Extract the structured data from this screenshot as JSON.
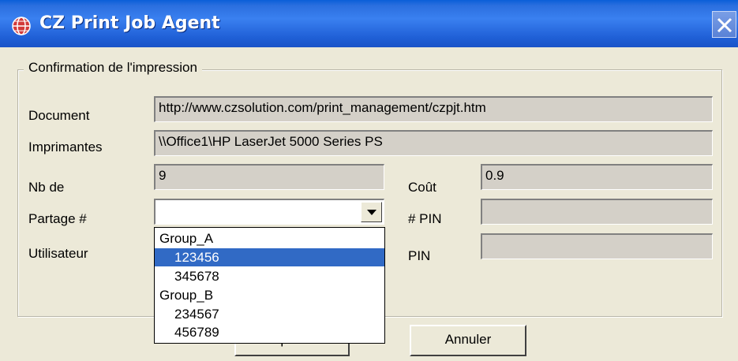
{
  "window": {
    "title": "CZ Print Job Agent",
    "app_icon": "globe-icon",
    "close_icon": "close-icon"
  },
  "group": {
    "legend": "Confirmation de l'impression"
  },
  "fields": {
    "document_label": "Document",
    "document_value": "http://www.czsolution.com/print_management/czpjt.htm",
    "printer_label": "Imprimantes",
    "printer_value": "\\\\Office1\\HP LaserJet 5000 Series PS",
    "nb_label": "Nb de",
    "nb_value": "9",
    "cost_label": "Coût",
    "cost_value": "0.9",
    "share_label": "Partage  #",
    "share_value": "",
    "pin_number_label": "# PIN",
    "pin_number_value": "",
    "user_label": "Utilisateur",
    "pin_label": "PIN",
    "pin_value": ""
  },
  "dropdown": {
    "options": [
      {
        "label": "Group_A",
        "type": "group"
      },
      {
        "label": "123456",
        "type": "item",
        "selected": true
      },
      {
        "label": "345678",
        "type": "item"
      },
      {
        "label": "Group_B",
        "type": "group"
      },
      {
        "label": "234567",
        "type": "item"
      },
      {
        "label": "456789",
        "type": "item"
      }
    ]
  },
  "buttons": {
    "print_label": "Imprimer",
    "cancel_label": "Annuler"
  },
  "colors": {
    "titlebar": "#2b6fdf",
    "window_bg": "#ece9d8",
    "selection": "#316ac5"
  }
}
